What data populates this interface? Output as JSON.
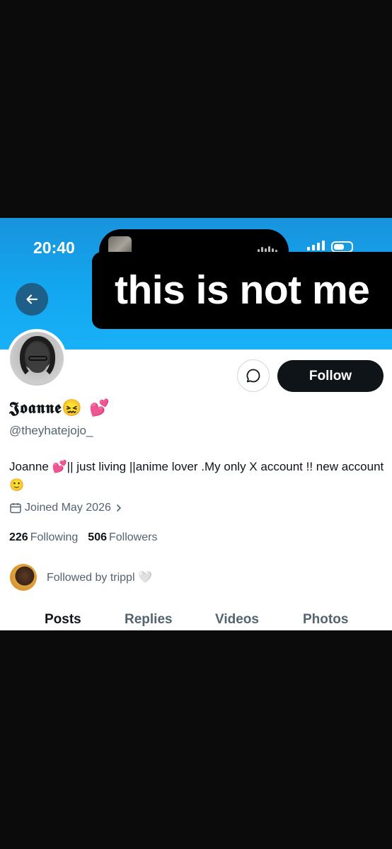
{
  "status": {
    "time": "20:40"
  },
  "caption": "this is not me",
  "profile": {
    "display_name": "𝕵𝖔𝖆𝖓𝖓𝖊😖 💕",
    "handle": "@theyhatejojo_",
    "bio": "Joanne 💕|| just living ||anime lover .My only X account !! new account 🙂",
    "joined": "Joined May 2026",
    "following_count": "226",
    "following_label": "Following",
    "followers_count": "506",
    "followers_label": "Followers",
    "followed_by": "Followed by trippl 🤍"
  },
  "actions": {
    "follow_label": "Follow"
  },
  "tabs": [
    "Posts",
    "Replies",
    "Videos",
    "Photos"
  ],
  "icons": {
    "back": "arrow-left-icon",
    "message": "chat-bubble-icon",
    "calendar": "calendar-icon",
    "chevron": "chevron-right-icon"
  },
  "colors": {
    "banner": "#1a9fe8",
    "follow_button": "#0f1419",
    "secondary_text": "#536471",
    "back_button": "#1d5f87"
  }
}
